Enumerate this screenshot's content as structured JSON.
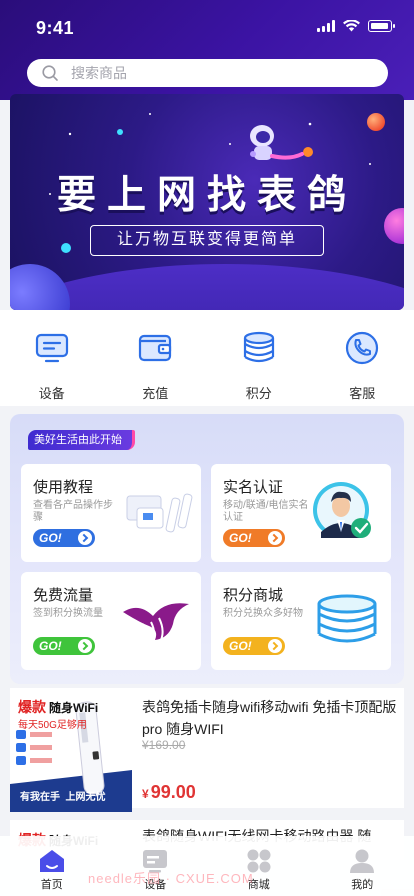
{
  "status_bar": {
    "time": "9:41"
  },
  "search": {
    "placeholder": "搜索商品"
  },
  "banner": {
    "title": "要上网找表鸽",
    "subtitle": "让万物互联变得更简单"
  },
  "quick_icons": [
    {
      "label": "设备",
      "icon": "monitor-icon"
    },
    {
      "label": "充值",
      "icon": "wallet-icon"
    },
    {
      "label": "积分",
      "icon": "coins-stack-icon"
    },
    {
      "label": "客服",
      "icon": "phone-icon"
    }
  ],
  "feature_panel": {
    "tag": "美好生活由此开始",
    "cards": [
      {
        "title": "使用教程",
        "desc": "查看各产品操作步骤",
        "go": "GO!"
      },
      {
        "title": "实名认证",
        "desc": "移动/联通/电信实名认证",
        "go": "GO!"
      },
      {
        "title": "免费流量",
        "desc": "签到积分换流量",
        "go": "GO!"
      },
      {
        "title": "积分商城",
        "desc": "积分兑换众多好物",
        "go": "GO!"
      }
    ]
  },
  "products": [
    {
      "title": "表鸽免插卡随身wifi移动wifi 免插卡顶配版pro 随身WIFI",
      "original_price": "¥169.00",
      "currency": "¥",
      "price": "99.00",
      "image_text": {
        "brand": "爆款",
        "name": "随身WiFi",
        "tagline": "每天50G足够用",
        "banner": "有我在手  上网无忧"
      }
    },
    {
      "title": "表鸽随身WIFI无线网卡移动路由器 随",
      "image_text": {
        "brand": "爆款",
        "name": "随身WiFi"
      }
    }
  ],
  "tabbar": [
    {
      "label": "首页",
      "icon": "home-icon"
    },
    {
      "label": "设备",
      "icon": "device-icon"
    },
    {
      "label": "商城",
      "icon": "mall-icon"
    },
    {
      "label": "我的",
      "icon": "user-icon"
    }
  ],
  "watermark": "needle乐园 · CXUE.COM",
  "colors": {
    "header": "#3b13a3",
    "accent_blue": "#2f6fe0",
    "price_red": "#e03434"
  }
}
